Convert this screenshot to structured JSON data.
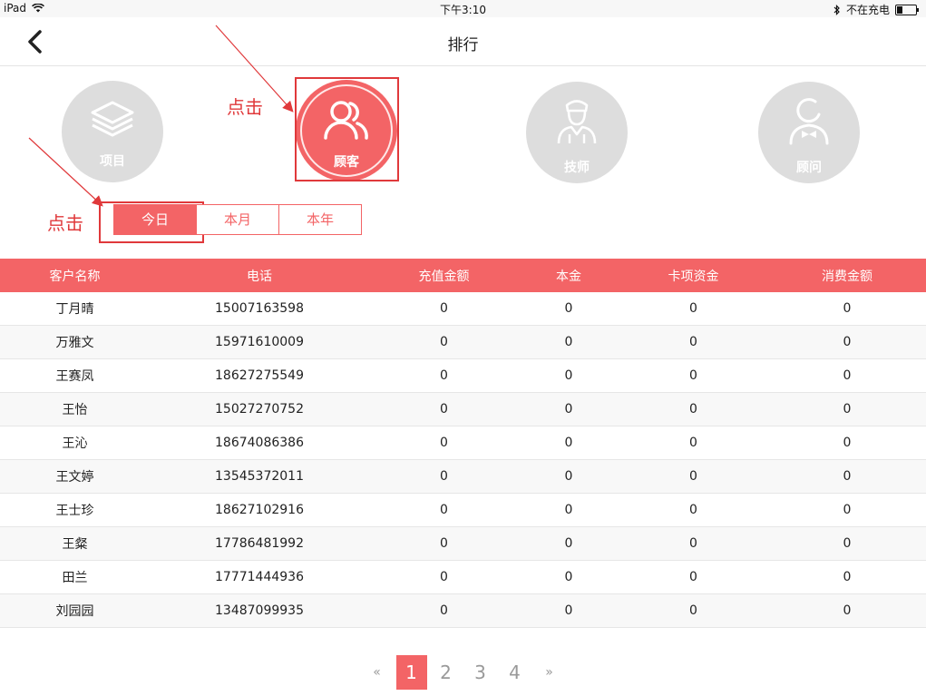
{
  "status_bar": {
    "device": "iPad",
    "time": "下午3:10",
    "charge_status": "不在充电"
  },
  "nav": {
    "title": "排行"
  },
  "categories": [
    {
      "label": "项目",
      "icon": "layers-icon",
      "active": false
    },
    {
      "label": "顾客",
      "icon": "customers-icon",
      "active": true
    },
    {
      "label": "技师",
      "icon": "technician-icon",
      "active": false
    },
    {
      "label": "顾问",
      "icon": "consultant-icon",
      "active": false
    }
  ],
  "annotations": {
    "click_label_1": "点击",
    "click_label_2": "点击"
  },
  "period_tabs": [
    {
      "label": "今日",
      "active": true
    },
    {
      "label": "本月",
      "active": false
    },
    {
      "label": "本年",
      "active": false
    }
  ],
  "table": {
    "columns": [
      "客户名称",
      "电话",
      "充值金额",
      "本金",
      "卡项资金",
      "消费金额"
    ],
    "rows": [
      [
        "丁月晴",
        "15007163598",
        "0",
        "0",
        "0",
        "0"
      ],
      [
        "万雅文",
        "15971610009",
        "0",
        "0",
        "0",
        "0"
      ],
      [
        "王赛凤",
        "18627275549",
        "0",
        "0",
        "0",
        "0"
      ],
      [
        "王怡",
        "15027270752",
        "0",
        "0",
        "0",
        "0"
      ],
      [
        "王沁",
        "18674086386",
        "0",
        "0",
        "0",
        "0"
      ],
      [
        "王文婷",
        "13545372011",
        "0",
        "0",
        "0",
        "0"
      ],
      [
        "王士珍",
        "18627102916",
        "0",
        "0",
        "0",
        "0"
      ],
      [
        "王粲",
        "17786481992",
        "0",
        "0",
        "0",
        "0"
      ],
      [
        "田兰",
        "17771444936",
        "0",
        "0",
        "0",
        "0"
      ],
      [
        "刘园园",
        "13487099935",
        "0",
        "0",
        "0",
        "0"
      ]
    ]
  },
  "pagination": {
    "prev": "«",
    "next": "»",
    "pages": [
      "1",
      "2",
      "3",
      "4"
    ],
    "current": "1"
  },
  "colors": {
    "accent": "#f36466",
    "annotation": "#e0393b",
    "inactive_circle": "#dddddd"
  }
}
